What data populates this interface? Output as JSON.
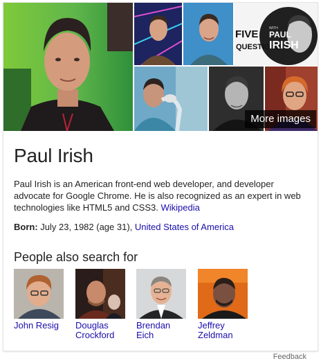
{
  "knowledge_panel": {
    "more_images_label": "More images",
    "collage_overlay": {
      "line1": "FIVE",
      "line2": "QUESTIONS",
      "line3": "PAUL",
      "line4": "IRISH",
      "with": "WITH"
    },
    "title": "Paul Irish",
    "description": "Paul Irish is an American front-end web developer, and developer advocate for Google Chrome. He is also recognized as an expert in web technologies like HTML5 and CSS3.",
    "description_link": "Wikipedia",
    "born_label": "Born:",
    "born_value": "July 23, 1982 (age 31),",
    "born_place": "United States of America",
    "people_also_search_heading": "People also search for",
    "people": [
      {
        "line1": "John Resig",
        "line2": ""
      },
      {
        "line1": "Douglas",
        "line2": "Crockford"
      },
      {
        "line1": "Brendan",
        "line2": "Eich"
      },
      {
        "line1": "Jeffrey",
        "line2": "Zeldman"
      }
    ],
    "feedback_label": "Feedback"
  },
  "colors": {
    "link": "#1a0dab",
    "text": "#222222",
    "muted": "#666666",
    "border": "#e5e5e5"
  }
}
